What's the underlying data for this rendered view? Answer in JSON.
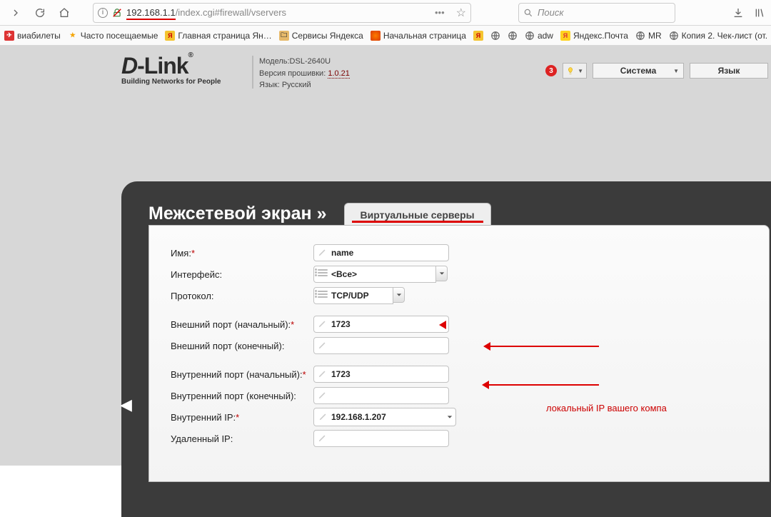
{
  "browser": {
    "url_host": "192.168.1.1",
    "url_rest": "/index.cgi#firewall/vservers",
    "search_placeholder": "Поиск",
    "bookmarks": [
      {
        "label": "виабилеты"
      },
      {
        "label": "Часто посещаемые"
      },
      {
        "label": "Главная страница Ян…"
      },
      {
        "label": "Сервисы Яндекса"
      },
      {
        "label": "Начальная страница"
      },
      {
        "label": "adw"
      },
      {
        "label": "Яндекс.Почта"
      },
      {
        "label": "MR"
      },
      {
        "label": "Копия 2. Чек-лист (от."
      }
    ]
  },
  "header": {
    "logo_tag": "Building Networks for People",
    "info": {
      "model_label": "Модель:",
      "model_value": "DSL-2640U",
      "fw_label": "Версия прошивки:",
      "fw_value": "1.0.21",
      "lang_label": "Язык:",
      "lang_value": "Русский"
    },
    "badge": "3",
    "system_dd": "Система",
    "lang_dd": "Язык"
  },
  "card": {
    "breadcrumb": "Межсетевой экран »",
    "tab": "Виртуальные серверы"
  },
  "form": {
    "name_label": "Имя:",
    "name_value": "name",
    "iface_label": "Интерфейс:",
    "iface_value": "<Все>",
    "proto_label": "Протокол:",
    "proto_value": "TCP/UDP",
    "ext_start_label": "Внешний порт (начальный):",
    "ext_start_value": "1723",
    "ext_end_label": "Внешний порт (конечный):",
    "ext_end_value": "",
    "int_start_label": "Внутренний порт (начальный):",
    "int_start_value": "1723",
    "int_end_label": "Внутренний порт (конечный):",
    "int_end_value": "",
    "int_ip_label": "Внутренний IP:",
    "int_ip_value": "192.168.1.207",
    "rem_ip_label": "Удаленный IP:",
    "rem_ip_value": ""
  },
  "annotation": "локальный IP вашего компа",
  "glyphs": {
    "dots": "•••",
    "star": "☆",
    "down": "▼"
  }
}
